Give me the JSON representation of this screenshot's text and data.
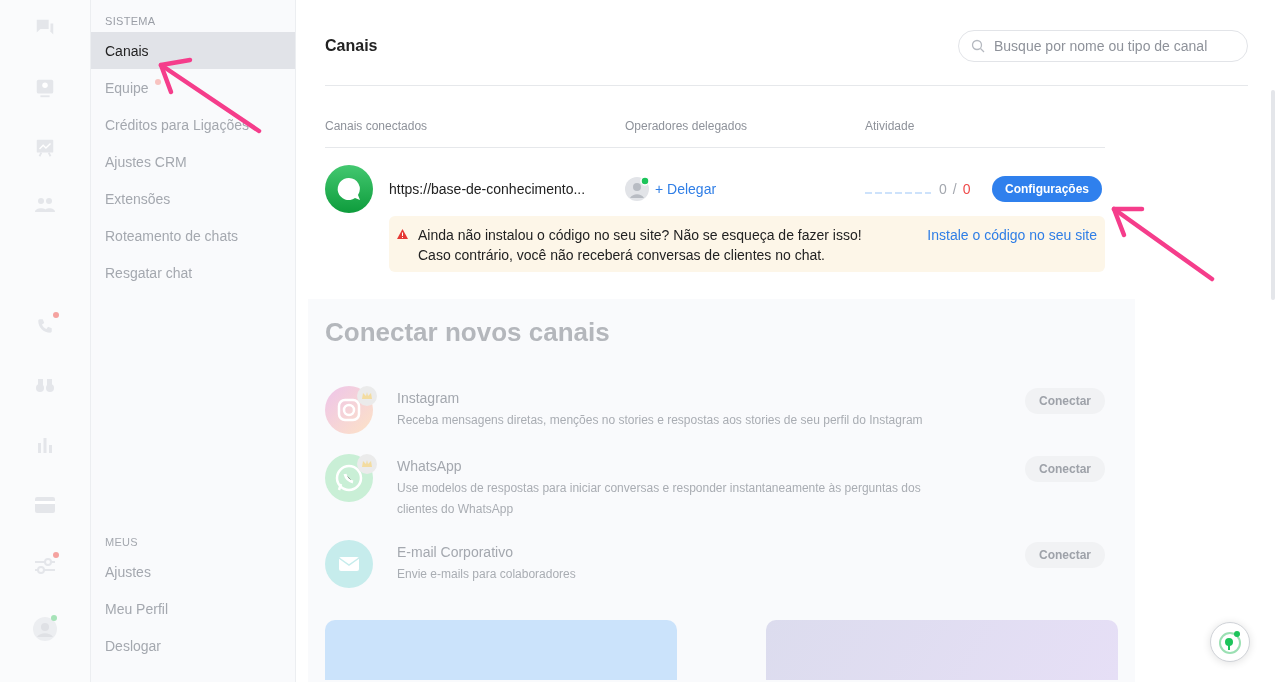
{
  "rail": {
    "icons": [
      {
        "kind": "chat"
      },
      {
        "kind": "contact"
      },
      {
        "kind": "board"
      },
      {
        "kind": "people"
      },
      {
        "kind": "phone",
        "color": "#f5a3a0"
      },
      {
        "kind": "binoculars"
      },
      {
        "kind": "bars"
      },
      {
        "kind": "card"
      },
      {
        "kind": "sliders",
        "color": "#f5a3a0"
      },
      {
        "kind": "avatar",
        "color": "#a6e3b8"
      }
    ]
  },
  "sidebar": {
    "sections": [
      {
        "title": "SISTEMA",
        "items": [
          {
            "label": "Canais",
            "selected": true
          },
          {
            "label": "Equipe",
            "selected": false,
            "dot": true
          },
          {
            "label": "Créditos para Ligações",
            "selected": false
          },
          {
            "label": "Ajustes CRM",
            "selected": false
          },
          {
            "label": "Extensões",
            "selected": false
          },
          {
            "label": "Roteamento de chats",
            "selected": false
          },
          {
            "label": "Resgatar chat",
            "selected": false
          }
        ]
      },
      {
        "title": "MEUS",
        "items": [
          {
            "label": "Ajustes",
            "selected": false
          },
          {
            "label": "Meu Perfil",
            "selected": false
          },
          {
            "label": "Deslogar",
            "selected": false
          }
        ]
      }
    ]
  },
  "header": {
    "title": "Canais",
    "search": {
      "placeholder": "Busque por nome ou tipo de canal"
    }
  },
  "table": {
    "columns": [
      "Canais conectados",
      "Operadores delegados",
      "Atividade"
    ],
    "rows": [
      {
        "name": "https://base-de-conhecimento...",
        "delegate": "+ Delegar",
        "count": "0",
        "separator": "/",
        "total": "0",
        "button": "Configurações",
        "warning": {
          "text": "Ainda não instalou o código no seu site? Não se esqueça de fazer isso! Caso contrário, você não receberá conversas de clientes no chat.",
          "link": "Instale o código no seu site"
        }
      }
    ]
  },
  "connect": {
    "title": "Conectar novos canais",
    "channels": [
      {
        "kind": "instagram",
        "name": "Instagram",
        "description": "Receba mensagens diretas, menções no stories e respostas aos stories de seu perfil do Instagram",
        "premium": true,
        "button": "Conectar"
      },
      {
        "kind": "whatsapp",
        "name": "WhatsApp",
        "description": "Use modelos de respostas para iniciar conversas e responder instantaneamente às perguntas dos clientes do WhatsApp",
        "premium": true,
        "button": "Conectar"
      },
      {
        "kind": "email",
        "name": "E-mail Corporativo",
        "description": "Envie e-mails para colaboradores",
        "premium": false,
        "button": "Conectar"
      }
    ]
  }
}
